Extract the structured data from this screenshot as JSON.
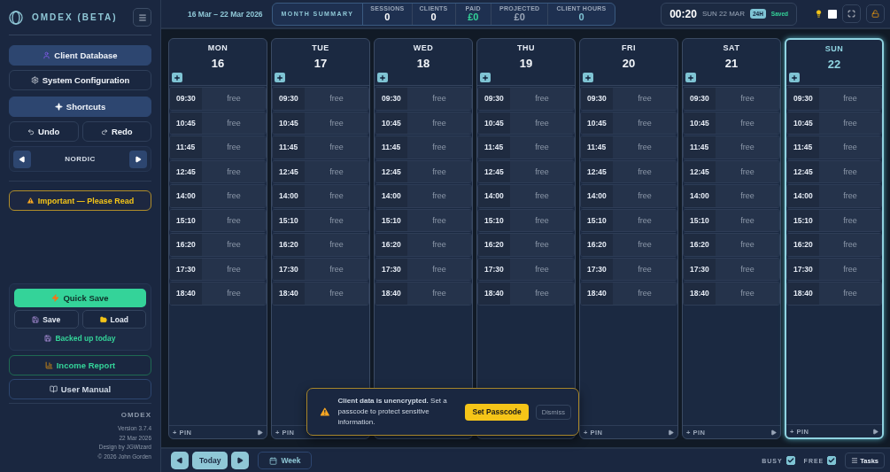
{
  "sidebar": {
    "brand": "OMDEX (BETA)",
    "nav": [
      {
        "label": "Client Database",
        "selected": true
      },
      {
        "label": "System Configuration",
        "selected": false
      },
      {
        "label": "Shortcuts",
        "selected": true
      }
    ],
    "history": [
      "Undo",
      "Redo"
    ],
    "theme": "NORDIC",
    "notice": "Important — Please Read",
    "quick_save": "Quick Save",
    "save": "Save",
    "load": "Load",
    "backup_status": "Backed up today",
    "links": [
      {
        "label": "Income Report",
        "kind": "report"
      },
      {
        "label": "User Manual",
        "kind": "manual"
      }
    ],
    "footer": {
      "app": "OMDEX",
      "lines": [
        "Version 3.7.4",
        "22 Mar 2026",
        "Design by JGWizard",
        "© 2026 John Gorden"
      ]
    }
  },
  "topbar": {
    "date_range": "16 Mar – 22 Mar 2026",
    "summary": {
      "title": "MONTH SUMMARY",
      "stats": [
        {
          "label": "SESSIONS",
          "value": "0",
          "color": "#ffffff"
        },
        {
          "label": "CLIENTS",
          "value": "0",
          "color": "#ffffff"
        },
        {
          "label": "PAID",
          "value": "£0",
          "color": "#34d399"
        },
        {
          "label": "PROJECTED",
          "value": "£0",
          "color": "#9aa6b8"
        },
        {
          "label": "CLIENT HOURS",
          "value": "0",
          "color": "#7fc4d4"
        }
      ]
    },
    "clock": {
      "time": "00:20",
      "date": "SUN 22 MAR",
      "format": "24H",
      "status": "Saved"
    }
  },
  "days": [
    {
      "name": "MON",
      "date": "16",
      "today": false,
      "pin": "+ PIN",
      "arrow": true,
      "slots": [
        {
          "time": "09:30",
          "status": "free"
        },
        {
          "time": "10:45",
          "status": "free"
        },
        {
          "time": "11:45",
          "status": "free"
        },
        {
          "time": "12:45",
          "status": "free"
        },
        {
          "time": "14:00",
          "status": "free"
        },
        {
          "time": "15:10",
          "status": "free"
        },
        {
          "time": "16:20",
          "status": "free"
        },
        {
          "time": "17:30",
          "status": "free"
        },
        {
          "time": "18:40",
          "status": "free"
        }
      ]
    },
    {
      "name": "TUE",
      "date": "17",
      "today": false,
      "pin": "+ PIN",
      "slots": [
        {
          "time": "09:30",
          "status": "free"
        },
        {
          "time": "10:45",
          "status": "free"
        },
        {
          "time": "11:45",
          "status": "free"
        },
        {
          "time": "12:45",
          "status": "free"
        },
        {
          "time": "14:00",
          "status": "free"
        },
        {
          "time": "15:10",
          "status": "free"
        },
        {
          "time": "16:20",
          "status": "free"
        },
        {
          "time": "17:30",
          "status": "free"
        },
        {
          "time": "18:40",
          "status": "free"
        }
      ]
    },
    {
      "name": "WED",
      "date": "18",
      "today": false,
      "slots": [
        {
          "time": "09:30",
          "status": "free"
        },
        {
          "time": "10:45",
          "status": "free"
        },
        {
          "time": "11:45",
          "status": "free"
        },
        {
          "time": "12:45",
          "status": "free"
        },
        {
          "time": "14:00",
          "status": "free"
        },
        {
          "time": "15:10",
          "status": "free"
        },
        {
          "time": "16:20",
          "status": "free"
        },
        {
          "time": "17:30",
          "status": "free"
        },
        {
          "time": "18:40",
          "status": "free"
        }
      ]
    },
    {
      "name": "THU",
      "date": "19",
      "today": false,
      "slots": [
        {
          "time": "09:30",
          "status": "free"
        },
        {
          "time": "10:45",
          "status": "free"
        },
        {
          "time": "11:45",
          "status": "free"
        },
        {
          "time": "12:45",
          "status": "free"
        },
        {
          "time": "14:00",
          "status": "free"
        },
        {
          "time": "15:10",
          "status": "free"
        },
        {
          "time": "16:20",
          "status": "free"
        },
        {
          "time": "17:30",
          "status": "free"
        },
        {
          "time": "18:40",
          "status": "free"
        }
      ]
    },
    {
      "name": "FRI",
      "date": "20",
      "today": false,
      "pin": "+ PIN",
      "arrow": true,
      "slots": [
        {
          "time": "09:30",
          "status": "free"
        },
        {
          "time": "10:45",
          "status": "free"
        },
        {
          "time": "11:45",
          "status": "free"
        },
        {
          "time": "12:45",
          "status": "free"
        },
        {
          "time": "14:00",
          "status": "free"
        },
        {
          "time": "15:10",
          "status": "free"
        },
        {
          "time": "16:20",
          "status": "free"
        },
        {
          "time": "17:30",
          "status": "free"
        },
        {
          "time": "18:40",
          "status": "free"
        }
      ]
    },
    {
      "name": "SAT",
      "date": "21",
      "today": false,
      "pin": "+ PIN",
      "arrow": true,
      "slots": [
        {
          "time": "09:30",
          "status": "free"
        },
        {
          "time": "10:45",
          "status": "free"
        },
        {
          "time": "11:45",
          "status": "free"
        },
        {
          "time": "12:45",
          "status": "free"
        },
        {
          "time": "14:00",
          "status": "free"
        },
        {
          "time": "15:10",
          "status": "free"
        },
        {
          "time": "16:20",
          "status": "free"
        },
        {
          "time": "17:30",
          "status": "free"
        },
        {
          "time": "18:40",
          "status": "free"
        }
      ]
    },
    {
      "name": "SUN",
      "date": "22",
      "today": true,
      "pin": "+ PIN",
      "arrow": true,
      "slots": [
        {
          "time": "09:30",
          "status": "free"
        },
        {
          "time": "10:45",
          "status": "free"
        },
        {
          "time": "11:45",
          "status": "free"
        },
        {
          "time": "12:45",
          "status": "free"
        },
        {
          "time": "14:00",
          "status": "free"
        },
        {
          "time": "15:10",
          "status": "free"
        },
        {
          "time": "16:20",
          "status": "free"
        },
        {
          "time": "17:30",
          "status": "free"
        },
        {
          "time": "18:40",
          "status": "free"
        }
      ]
    }
  ],
  "toast": {
    "message": "**Client data is unencrypted.** Set a passcode to protect sensitive information.",
    "action": "Set Passcode",
    "dismiss": "Dismiss"
  },
  "bottombar": {
    "today": "Today",
    "view": "Week",
    "filters": [
      {
        "label": "BUSY",
        "checked": true
      },
      {
        "label": "FREE",
        "checked": true
      }
    ],
    "tasks": "Tasks"
  }
}
